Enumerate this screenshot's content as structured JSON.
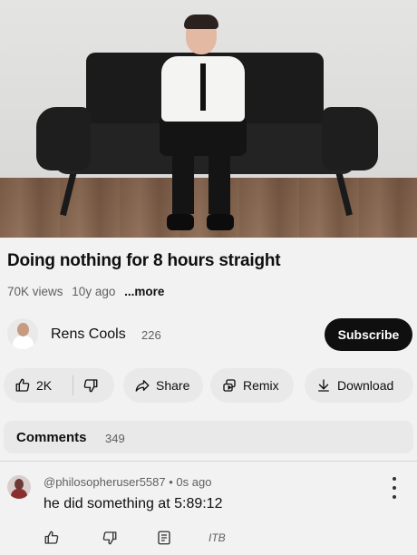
{
  "video": {
    "title": "Doing nothing for 8 hours straight",
    "views": "70K views",
    "age": "10y ago",
    "more": "...more"
  },
  "channel": {
    "name": "Rens Cools",
    "subscribers": "226",
    "subscribe_label": "Subscribe"
  },
  "actions": {
    "likes": "2K",
    "share_label": "Share",
    "remix_label": "Remix",
    "download_label": "Download"
  },
  "comments": {
    "label": "Comments",
    "count": "349",
    "top": {
      "author": "@philosopheruser5587",
      "time": "0s ago",
      "text": "he did something at 5:89:12",
      "extra": "ITB"
    }
  },
  "icons": {
    "like": "thumbs-up-icon",
    "dislike": "thumbs-down-icon",
    "share": "share-arrow-icon",
    "remix": "remix-icon",
    "download": "download-arrow-icon",
    "reply": "reply-icon",
    "more": "vertical-dots-icon"
  },
  "colors": {
    "subscribe_bg": "#0f0f0f",
    "pill_bg": "#e9e9e9",
    "muted_text": "#606060"
  }
}
